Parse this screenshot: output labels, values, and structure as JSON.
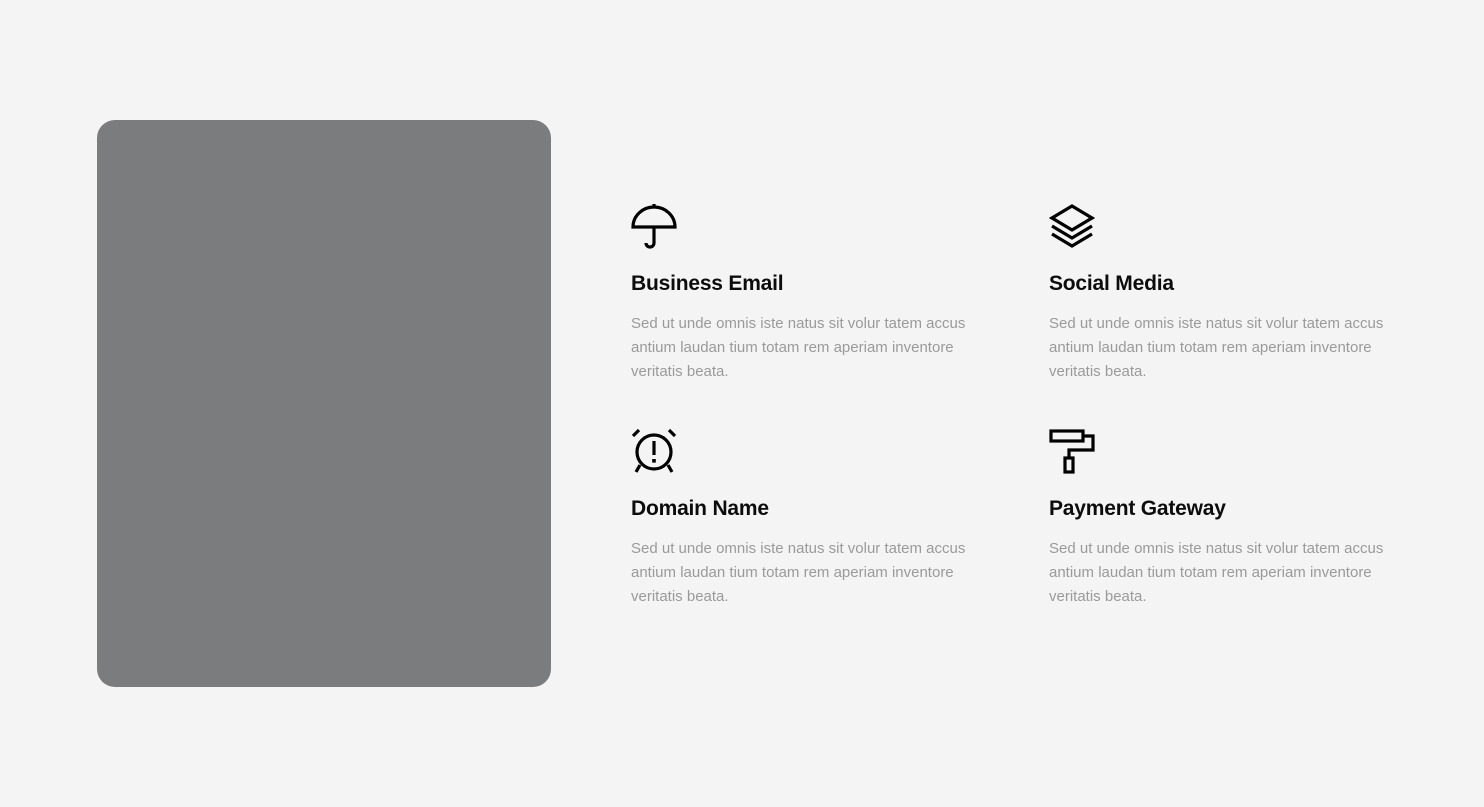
{
  "features": [
    {
      "icon": "umbrella-icon",
      "title": "Business Email",
      "description": "Sed ut unde omnis iste natus sit volur tatem accus antium laudan tium totam rem aperiam inventore veritatis beata."
    },
    {
      "icon": "layers-icon",
      "title": "Social Media",
      "description": "Sed ut unde omnis iste natus sit volur tatem accus antium laudan tium totam rem aperiam inventore veritatis beata."
    },
    {
      "icon": "alarm-clock-icon",
      "title": "Domain Name",
      "description": "Sed ut unde omnis iste natus sit volur tatem accus antium laudan tium totam rem aperiam inventore veritatis beata."
    },
    {
      "icon": "paint-roller-icon",
      "title": "Payment Gateway",
      "description": "Sed ut unde omnis iste natus sit volur tatem accus antium laudan tium totam rem aperiam inventore veritatis beata."
    }
  ],
  "colors": {
    "background": "#f4f4f4",
    "image_placeholder": "#7b7c7e",
    "title_text": "#0c0c0c",
    "description_text": "#9a9a9a"
  }
}
